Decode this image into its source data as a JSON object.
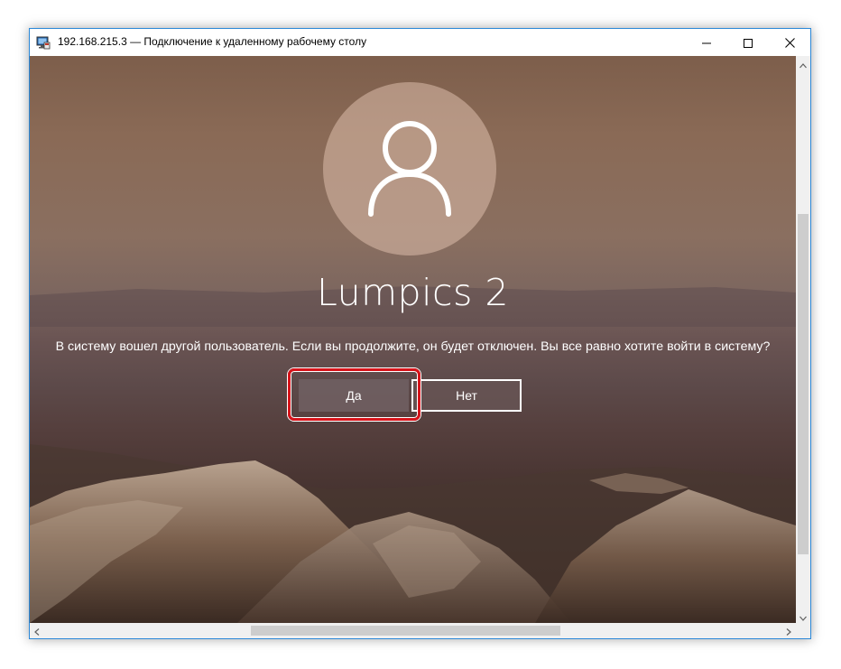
{
  "window": {
    "title": "192.168.215.3 — Подключение к удаленному рабочему столу",
    "app_icon": "remote-desktop-icon",
    "controls": [
      "minimize-icon",
      "maximize-icon",
      "close-icon"
    ]
  },
  "login": {
    "avatar_icon": "user-icon",
    "username": "Lumpics 2",
    "message": "В систему вошел другой пользователь. Если вы продолжите, он будет отключен. Вы все равно хотите войти в систему?",
    "yes_label": "Да",
    "no_label": "Нет"
  },
  "annotation": {
    "highlight_color": "#d7141b"
  },
  "colors": {
    "titlebar_bg": "#ffffff",
    "window_border": "#2b88d8",
    "scrollbar_track": "#f0f0f0",
    "scrollbar_thumb": "#cdcdcd"
  }
}
